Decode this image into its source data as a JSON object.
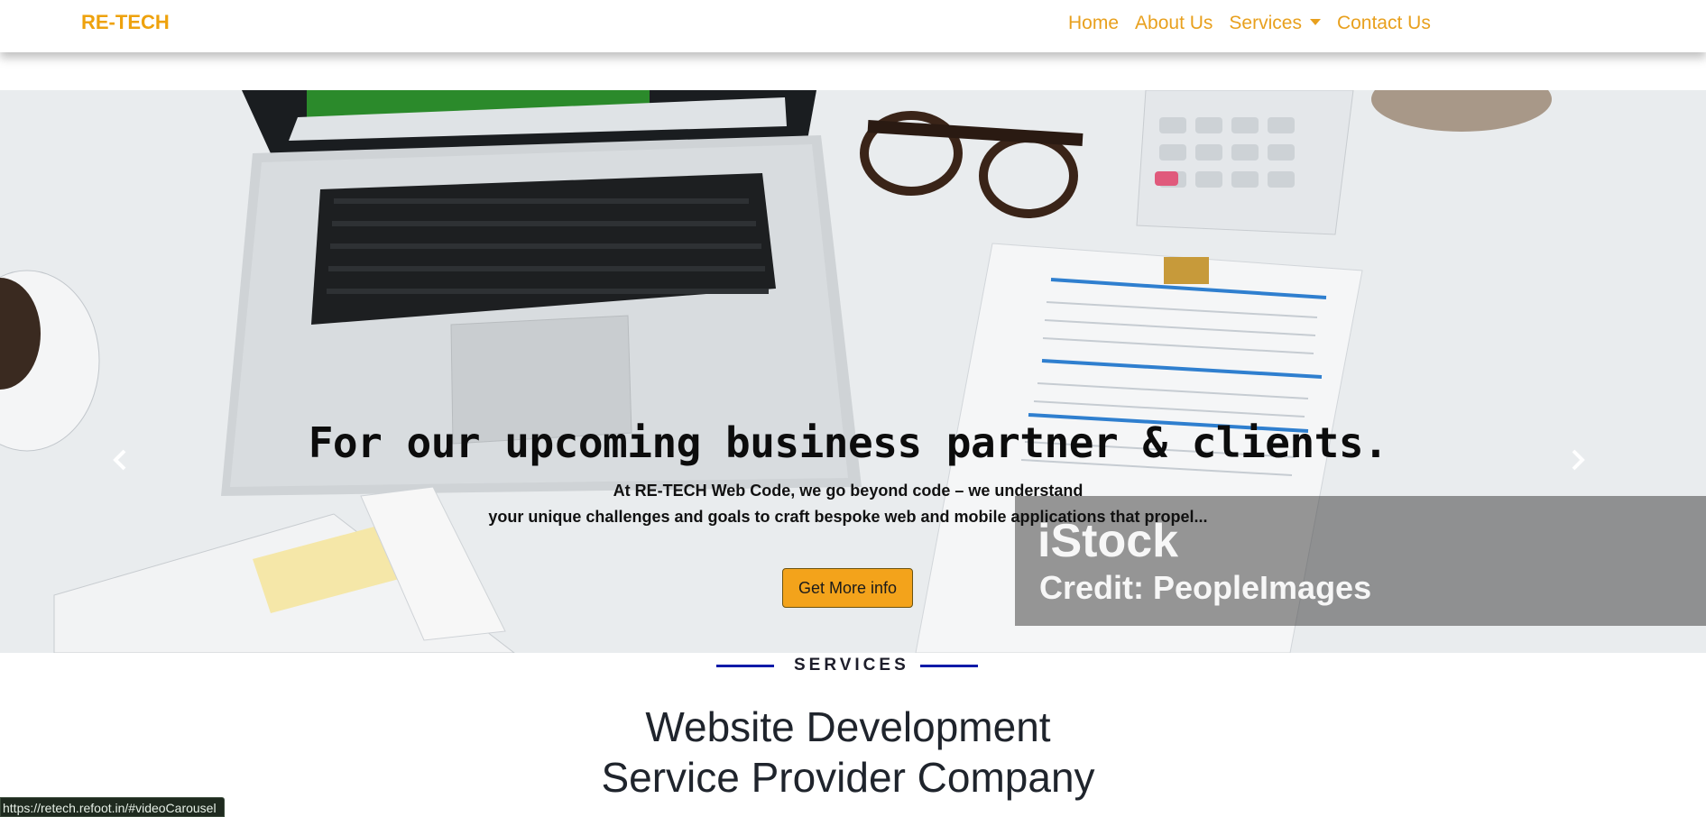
{
  "navbar": {
    "brand": "RE-TECH",
    "links": [
      {
        "label": "Home"
      },
      {
        "label": "About Us"
      },
      {
        "label": "Services",
        "dropdown": true
      },
      {
        "label": "Contact Us"
      }
    ],
    "accent_color": "#e8a01e"
  },
  "hero": {
    "title": "For our upcoming business partner & clients.",
    "subtitle_line1": "At RE-TECH Web Code, we go beyond code – we understand",
    "subtitle_line2": "your unique challenges and goals to craft bespoke web and mobile applications that propel...",
    "cta_label": "Get More info",
    "cta_color": "#f3a31b",
    "watermark_brand": "iStock",
    "watermark_credit": "Credit: PeopleImages",
    "prev_icon": "chevron-left-icon",
    "next_icon": "chevron-right-icon"
  },
  "services": {
    "eyebrow": "SERVICES",
    "heading_line1": "Website Development",
    "heading_line2": "Service Provider Company",
    "line_color": "#0c1aa8"
  },
  "status_bar": {
    "url": "https://retech.refoot.in/#videoCarousel"
  }
}
